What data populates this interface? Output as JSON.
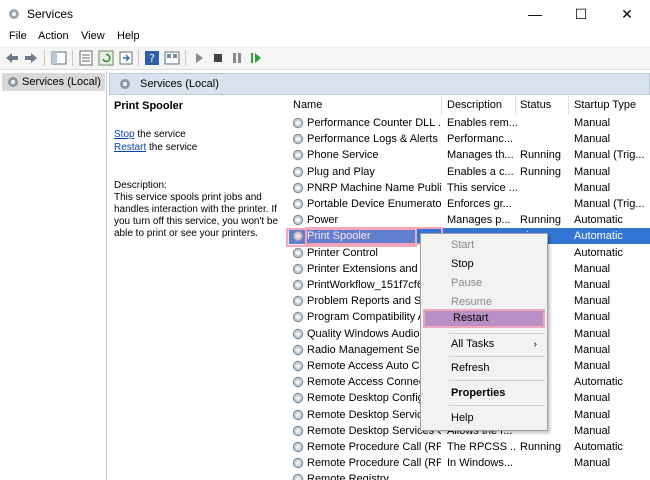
{
  "window": {
    "title": "Services"
  },
  "menu": [
    "File",
    "Action",
    "View",
    "Help"
  ],
  "tree": {
    "root": "Services (Local)"
  },
  "panel": {
    "header": "Services (Local)"
  },
  "description": {
    "service_name": "Print Spooler",
    "stop_link": "Stop",
    "stop_suffix": " the service",
    "restart_link": "Restart",
    "restart_suffix": " the service",
    "desc_label": "Description:",
    "desc_text": "This service spools print jobs and handles interaction with the printer. If you turn off this service, you won't be able to print or see your printers."
  },
  "table": {
    "columns": [
      "Name",
      "Description",
      "Status",
      "Startup Type"
    ],
    "rows": [
      [
        "Performance Counter DLL ...",
        "Enables rem...",
        "",
        "Manual"
      ],
      [
        "Performance Logs & Alerts",
        "Performanc...",
        "",
        "Manual"
      ],
      [
        "Phone Service",
        "Manages th...",
        "Running",
        "Manual (Trig..."
      ],
      [
        "Plug and Play",
        "Enables a c...",
        "Running",
        "Manual"
      ],
      [
        "PNRP Machine Name Publi...",
        "This service ...",
        "",
        "Manual"
      ],
      [
        "Portable Device Enumerator...",
        "Enforces gr...",
        "",
        "Manual (Trig..."
      ],
      [
        "Power",
        "Manages p...",
        "Running",
        "Automatic"
      ],
      [
        "Print Spooler",
        "",
        "ning",
        "Automatic"
      ],
      [
        "Printer Control",
        "",
        "",
        "Automatic"
      ],
      [
        "Printer Extensions and No",
        "",
        "",
        "Manual"
      ],
      [
        "PrintWorkflow_151f7cf6",
        "",
        "",
        "Manual"
      ],
      [
        "Problem Reports and Solu",
        "",
        "",
        "Manual"
      ],
      [
        "Program Compatibility A",
        "",
        "",
        "Manual"
      ],
      [
        "Quality Windows Audio V",
        "",
        "",
        "Manual"
      ],
      [
        "Radio Management Servi",
        "",
        "",
        "Manual"
      ],
      [
        "Remote Access Auto Con",
        "",
        "",
        "Manual"
      ],
      [
        "Remote Access Connecti",
        "",
        "",
        "Automatic"
      ],
      [
        "Remote Desktop Configu",
        "",
        "",
        "Manual"
      ],
      [
        "Remote Desktop Services",
        "",
        "",
        "Manual"
      ],
      [
        "Remote Desktop Services U...",
        "Allows the r...",
        "",
        "Manual"
      ],
      [
        "Remote Procedure Call (RPC)",
        "The RPCSS ...",
        "Running",
        "Automatic"
      ],
      [
        "Remote Procedure Call (RP...",
        "In Windows...",
        "",
        "Manual"
      ],
      [
        "Remote Registry",
        "",
        "",
        ""
      ]
    ]
  },
  "context_menu": {
    "start": "Start",
    "stop": "Stop",
    "pause": "Pause",
    "resume": "Resume",
    "restart": "Restart",
    "all_tasks": "All Tasks",
    "refresh": "Refresh",
    "properties": "Properties",
    "help": "Help"
  },
  "colors": {
    "selection": "#3375d7",
    "highlight": "#f0a7bb",
    "hover": "#b890c6"
  }
}
